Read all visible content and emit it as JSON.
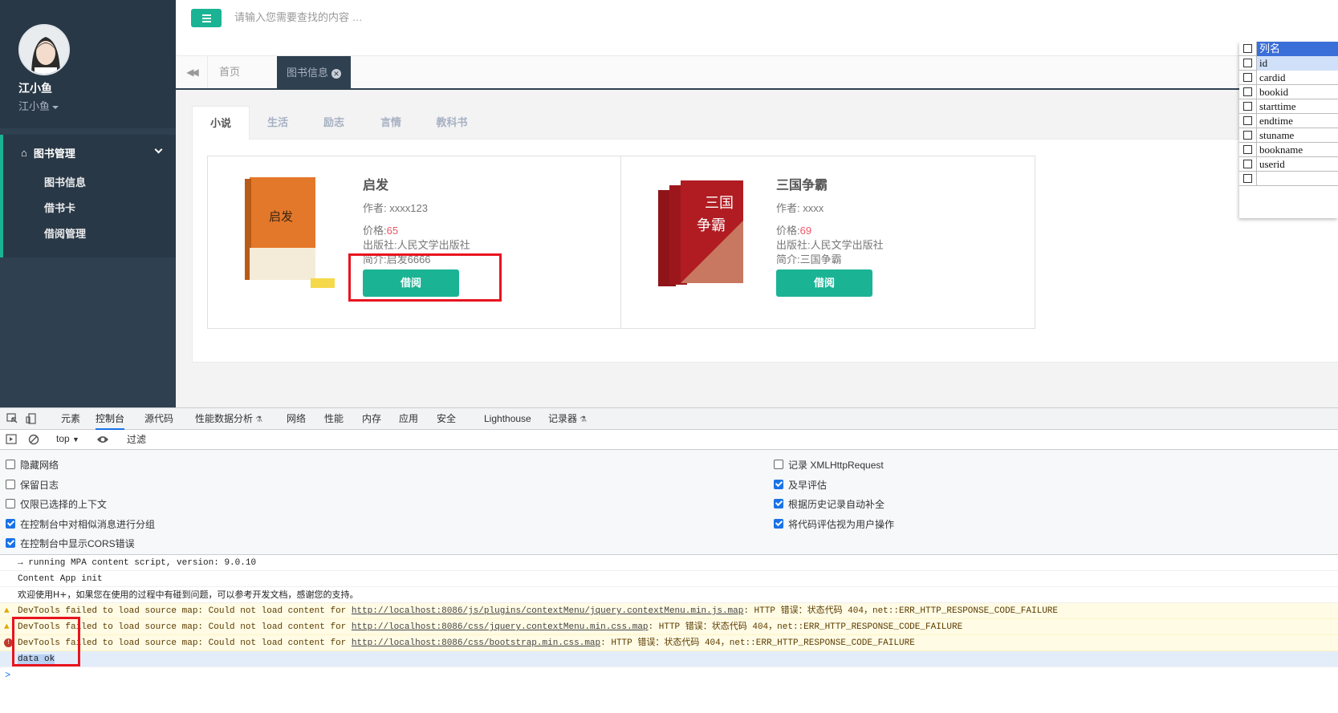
{
  "sidebar": {
    "user_name": "江小鱼",
    "user_role": "江小鱼",
    "group_label": "图书管理",
    "items": [
      {
        "label": "图书信息"
      },
      {
        "label": "借书卡"
      },
      {
        "label": "借阅管理"
      }
    ]
  },
  "topbar": {
    "search_placeholder": "请输入您需要查找的内容 …"
  },
  "content_tabs": {
    "home": "首页",
    "books": "图书信息"
  },
  "categories": [
    "小说",
    "生活",
    "励志",
    "言情",
    "教科书"
  ],
  "books": [
    {
      "title": "启发",
      "author_label": "作者: ",
      "author": "xxxx123",
      "price_label": "价格:",
      "price": "65",
      "publisher": "出版社:人民文学出版社",
      "intro": "简介:启发6666",
      "button": "借阅",
      "cover_color": "#e4782a"
    },
    {
      "title": "三国争霸",
      "author_label": "作者: ",
      "author": "xxxx",
      "price_label": "价格:",
      "price": "69",
      "publisher": "出版社:人民文学出版社",
      "intro": "简介:三国争霸",
      "button": "借阅",
      "cover_color": "#b01c22"
    }
  ],
  "column_popup": {
    "header": "列名",
    "columns": [
      "id",
      "cardid",
      "bookid",
      "starttime",
      "endtime",
      "stuname",
      "bookname",
      "userid",
      ""
    ]
  },
  "devtools": {
    "tabs": [
      "元素",
      "控制台",
      "源代码",
      "性能数据分析",
      "网络",
      "性能",
      "内存",
      "应用",
      "安全",
      "Lighthouse",
      "记录器"
    ],
    "active_tab": "控制台",
    "context": "top",
    "filter_placeholder": "过滤",
    "settings_left": [
      {
        "label": "隐藏网络",
        "checked": false
      },
      {
        "label": "保留日志",
        "checked": false
      },
      {
        "label": "仅限已选择的上下文",
        "checked": false
      },
      {
        "label": "在控制台中对相似消息进行分组",
        "checked": true
      },
      {
        "label": "在控制台中显示CORS错误",
        "checked": true
      }
    ],
    "settings_right": [
      {
        "label": "记录 XMLHttpRequest",
        "checked": false
      },
      {
        "label": "及早评估",
        "checked": true
      },
      {
        "label": "根据历史记录自动补全",
        "checked": true
      },
      {
        "label": "将代码评估视为用户操作",
        "checked": true
      }
    ],
    "console": {
      "line1": "→ running MPA content script, version: 9.0.10",
      "line2": "Content App init",
      "line3": "欢迎使用H+，如果您在使用的过程中有碰到问题，可以参考开发文档，感谢您的支持。",
      "warn1_pre": "DevTools failed to load source map: Could not load content for ",
      "warn1_link": "http://localhost:8086/js/plugins/contextMenu/jquery.contextMenu.min.js.map",
      "warn1_post": ": HTTP 错误：状态代码 404，net::ERR_HTTP_RESPONSE_CODE_FAILURE",
      "warn2_pre": "DevTools failed to load source map: Could not load content for ",
      "warn2_link": "http://localhost:8086/css/jquery.contextMenu.min.css.map",
      "warn2_post": ": HTTP 错误：状态代码 404，net::ERR_HTTP_RESPONSE_CODE_FAILURE",
      "err1_pre": "DevTools failed to load source map: Could not load content for ",
      "err1_link": "http://localhost:8086/css/bootstrap.min.css.map",
      "err1_post": ": HTTP 错误：状态代码 404，net::ERR_HTTP_RESPONSE_CODE_FAILURE",
      "log": "data ok",
      "prompt": ">"
    }
  },
  "colors": {
    "accent": "#1ab394",
    "sidebar": "#2f4050",
    "highlight_box": "#e8141f"
  }
}
